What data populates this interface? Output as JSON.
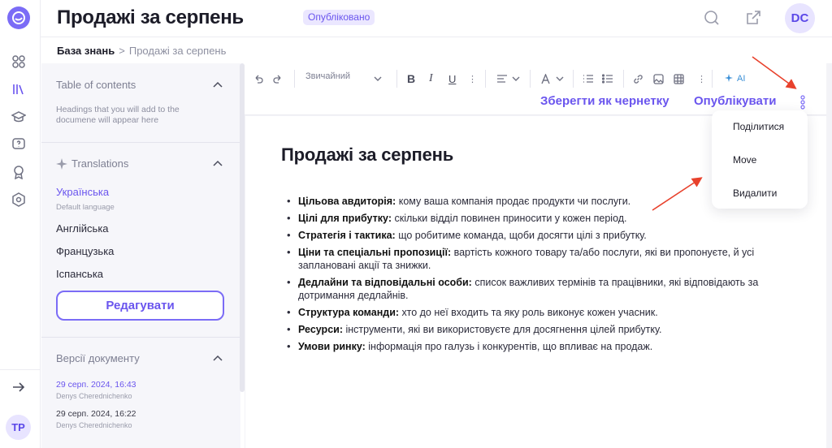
{
  "header": {
    "title": "Продажі за серпень",
    "status_badge": "Опубліковано",
    "user_initials": "DC"
  },
  "breadcrumb": {
    "root": "База знань",
    "separator": ">",
    "current": "Продажі за серпень"
  },
  "rail": {
    "user_initials": "TP"
  },
  "sidebar": {
    "toc": {
      "title": "Table of contents",
      "note": "Headings that you will add to the documene will appear here"
    },
    "translations": {
      "title": "Translations",
      "languages": [
        {
          "label": "Українська",
          "sub": "Default language"
        },
        {
          "label": "Англійська"
        },
        {
          "label": "Французька"
        },
        {
          "label": "Іспанська"
        }
      ],
      "edit_button": "Редагувати"
    },
    "versions": {
      "title": "Версії документу",
      "items": [
        {
          "date": "29 серп. 2024, 16:43",
          "author": "Denys Cherednichenko"
        },
        {
          "date": "29 серп. 2024, 16:22",
          "author": "Denys Cherednichenko"
        }
      ]
    }
  },
  "toolbar": {
    "text_style": "Звичайний",
    "ai_label": "AI",
    "save_draft": "Зберегти як чернетку",
    "publish": "Опублікувати"
  },
  "menu": {
    "items": [
      "Поділитися",
      "Move",
      "Видалити"
    ]
  },
  "document": {
    "title": "Продажі за серпень",
    "items": [
      {
        "term": "Цільова авдиторія:",
        "text": " кому ваша компанія продає продукти чи послуги."
      },
      {
        "term": "Цілі для прибутку:",
        "text": " скільки відділ повинен приносити у кожен період."
      },
      {
        "term": "Стратегія і тактика:",
        "text": " що робитиме команда, щоби досягти цілі з прибутку."
      },
      {
        "term": "Ціни та спеціальні пропозиції:",
        "text": " вартість кожного товару та/або послуги, які ви пропонуєте, й усі заплановані акції та знижки."
      },
      {
        "term": "Дедлайни та відповідальні особи:",
        "text": " список важливих термінів та працівники, які відповідають за дотримання дедлайнів."
      },
      {
        "term": "Структура команди:",
        "text": " хто до неї входить та яку роль виконує кожен учасник."
      },
      {
        "term": "Ресурси:",
        "text": " інструменти, які ви використовуєте для досягнення цілей прибутку."
      },
      {
        "term": "Умови ринку:",
        "text": " інформація про галузь і конкурентів, що впливає на продаж."
      }
    ]
  },
  "colors": {
    "accent": "#6a55ee",
    "annotation_arrow": "#e8412c"
  }
}
